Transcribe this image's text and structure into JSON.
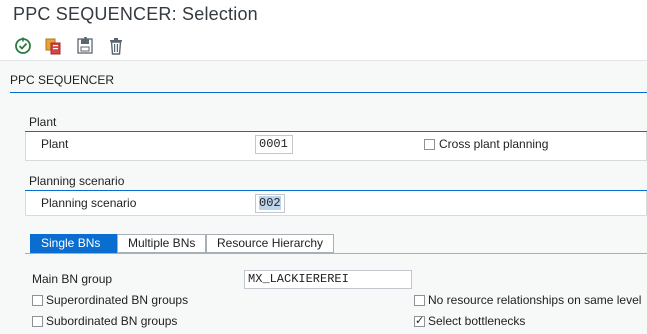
{
  "window": {
    "title": "PPC SEQUENCER: Selection"
  },
  "toolbar": {
    "buttons": [
      {
        "icon": "execute-icon"
      },
      {
        "icon": "copy-variant-icon"
      },
      {
        "icon": "save-variant-icon"
      },
      {
        "icon": "delete-icon"
      }
    ]
  },
  "section": {
    "title": "PPC SEQUENCER"
  },
  "plant_group": {
    "title": "Plant",
    "plant_label": "Plant",
    "plant_value": "0001",
    "cross_plant_label": "Cross plant planning",
    "cross_plant_checked": false
  },
  "scenario_group": {
    "title": "Planning scenario",
    "scenario_label": "Planning scenario",
    "scenario_value": "002"
  },
  "tabs": [
    {
      "label": "Single BNs",
      "active": true
    },
    {
      "label": "Multiple BNs",
      "active": false
    },
    {
      "label": "Resource Hierarchy",
      "active": false
    }
  ],
  "single_bns": {
    "main_bn_group_label": "Main BN group",
    "main_bn_group_value": "MX_LACKIEREREI",
    "superordinated_label": "Superordinated BN groups",
    "superordinated_checked": false,
    "subordinated_label": "Subordinated BN groups",
    "subordinated_checked": false,
    "no_resource_rel_label": "No resource relationships on same level",
    "no_resource_rel_checked": false,
    "select_bottlenecks_label": "Select bottlenecks",
    "select_bottlenecks_checked": true
  },
  "colors": {
    "accent": "#0a6ed1",
    "background": "#f7f8f8"
  }
}
